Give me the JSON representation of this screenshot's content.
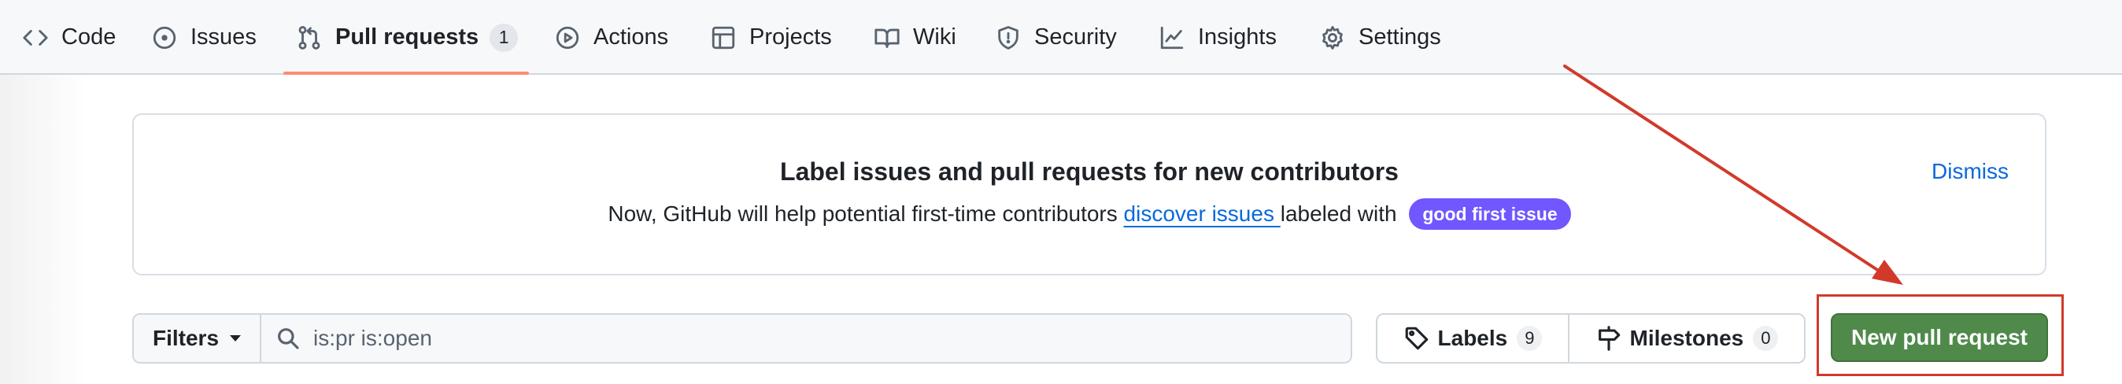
{
  "nav": {
    "code": "Code",
    "issues": "Issues",
    "pull_requests": "Pull requests",
    "pull_requests_count": "1",
    "actions": "Actions",
    "projects": "Projects",
    "wiki": "Wiki",
    "security": "Security",
    "insights": "Insights",
    "settings": "Settings"
  },
  "banner": {
    "title": "Label issues and pull requests for new contributors",
    "text_before": "Now, GitHub will help potential first-time contributors ",
    "link": "discover issues ",
    "text_after": "labeled with ",
    "label": "good first issue",
    "dismiss": "Dismiss"
  },
  "filter_bar": {
    "filters_label": "Filters",
    "search_value": "is:pr is:open",
    "labels_label": "Labels",
    "labels_count": "9",
    "milestones_label": "Milestones",
    "milestones_count": "0",
    "new_pr_label": "New pull request"
  },
  "colors": {
    "accent_underline": "#fd8c73",
    "link": "#0969da",
    "label_purple": "#7057ff",
    "primary_button": "#4f8a4b",
    "annotation_red": "#d13a2b"
  }
}
